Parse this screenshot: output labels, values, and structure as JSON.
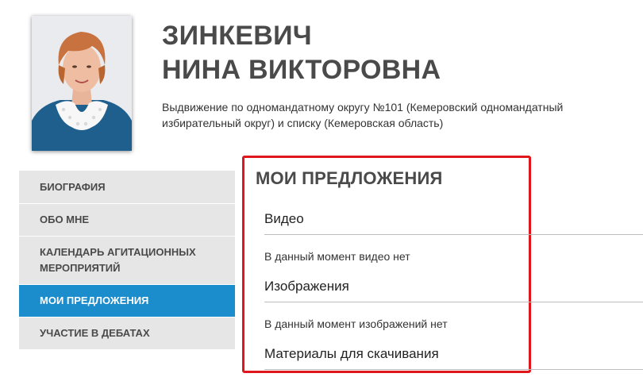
{
  "candidate": {
    "surname": "ЗИНКЕВИЧ",
    "given_names": "НИНА ВИКТОРОВНА",
    "nomination": "Выдвижение по одномандатному округу №101 (Кемеровский одномандатный избирательный округ) и списку (Кемеровская область)"
  },
  "sidebar": {
    "items": [
      {
        "label": "БИОГРАФИЯ",
        "active": false
      },
      {
        "label": "ОБО МНЕ",
        "active": false
      },
      {
        "label": "КАЛЕНДАРЬ АГИТАЦИОННЫХ МЕРОПРИЯТИЙ",
        "active": false
      },
      {
        "label": "МОИ ПРЕДЛОЖЕНИЯ",
        "active": true
      },
      {
        "label": "УЧАСТИЕ В ДЕБАТАХ",
        "active": false
      }
    ]
  },
  "proposals": {
    "title": "МОИ ПРЕДЛОЖЕНИЯ",
    "sections": [
      {
        "heading": "Видео",
        "note": "В данный момент видео нет"
      },
      {
        "heading": "Изображения",
        "note": "В данный момент изображений нет"
      },
      {
        "heading": "Материалы для скачивания"
      }
    ]
  },
  "colors": {
    "accent": "#1b8ccc",
    "highlight_border": "#e0161d",
    "sidebar_bg": "#e6e6e6",
    "heading_text": "#4a4a4a"
  }
}
